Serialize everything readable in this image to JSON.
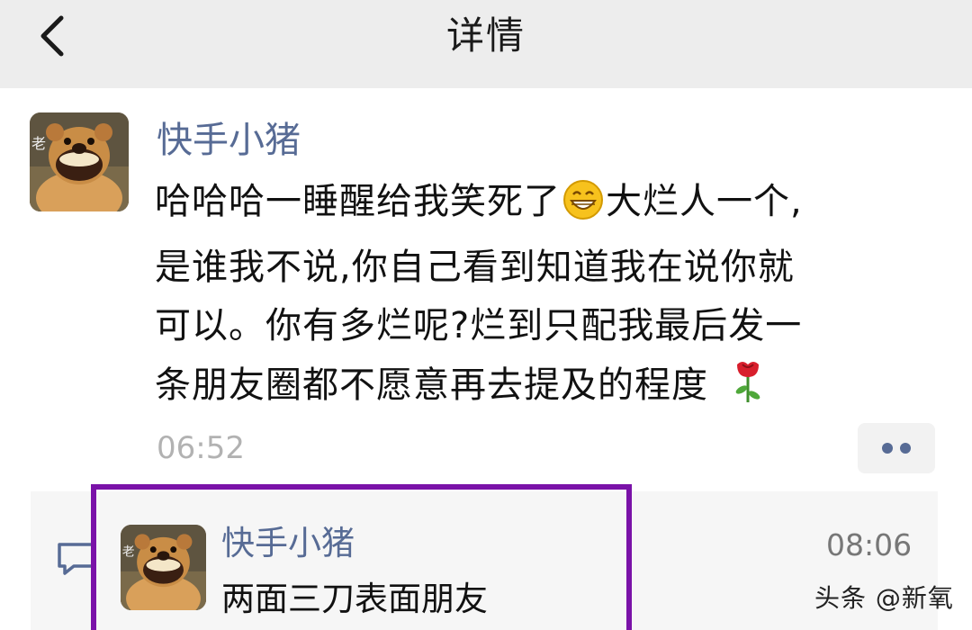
{
  "header": {
    "title": "详情",
    "back_icon": "chevron-left-icon"
  },
  "post": {
    "author": "快手小猪",
    "avatar_icon": "bear-avatar",
    "text_lines": [
      {
        "a": "哈哈哈一睡醒给我笑死了",
        "b": "大烂人一个,"
      },
      {
        "a": "是谁我不说,你自己看到知道我在说你就"
      },
      {
        "a": "可以。你有多烂呢?烂到只配我最后发一"
      },
      {
        "a": "条朋友圈都不愿意再去提及的程度"
      }
    ],
    "emoji_1": "grinning-face-icon",
    "emoji_2": "rose-icon",
    "time": "06:52",
    "more_icon": "more-dots-icon"
  },
  "comment": {
    "icon": "comment-icon",
    "author": "快手小猪",
    "text": "两面三刀表面朋友",
    "time": "08:06",
    "highlight_color": "#7a12a8"
  },
  "watermark": "头条 @新氧",
  "colors": {
    "header_bg": "#ededed",
    "name": "#576b95",
    "time": "#b2b2b2",
    "comment_bg": "#f6f6f6"
  }
}
